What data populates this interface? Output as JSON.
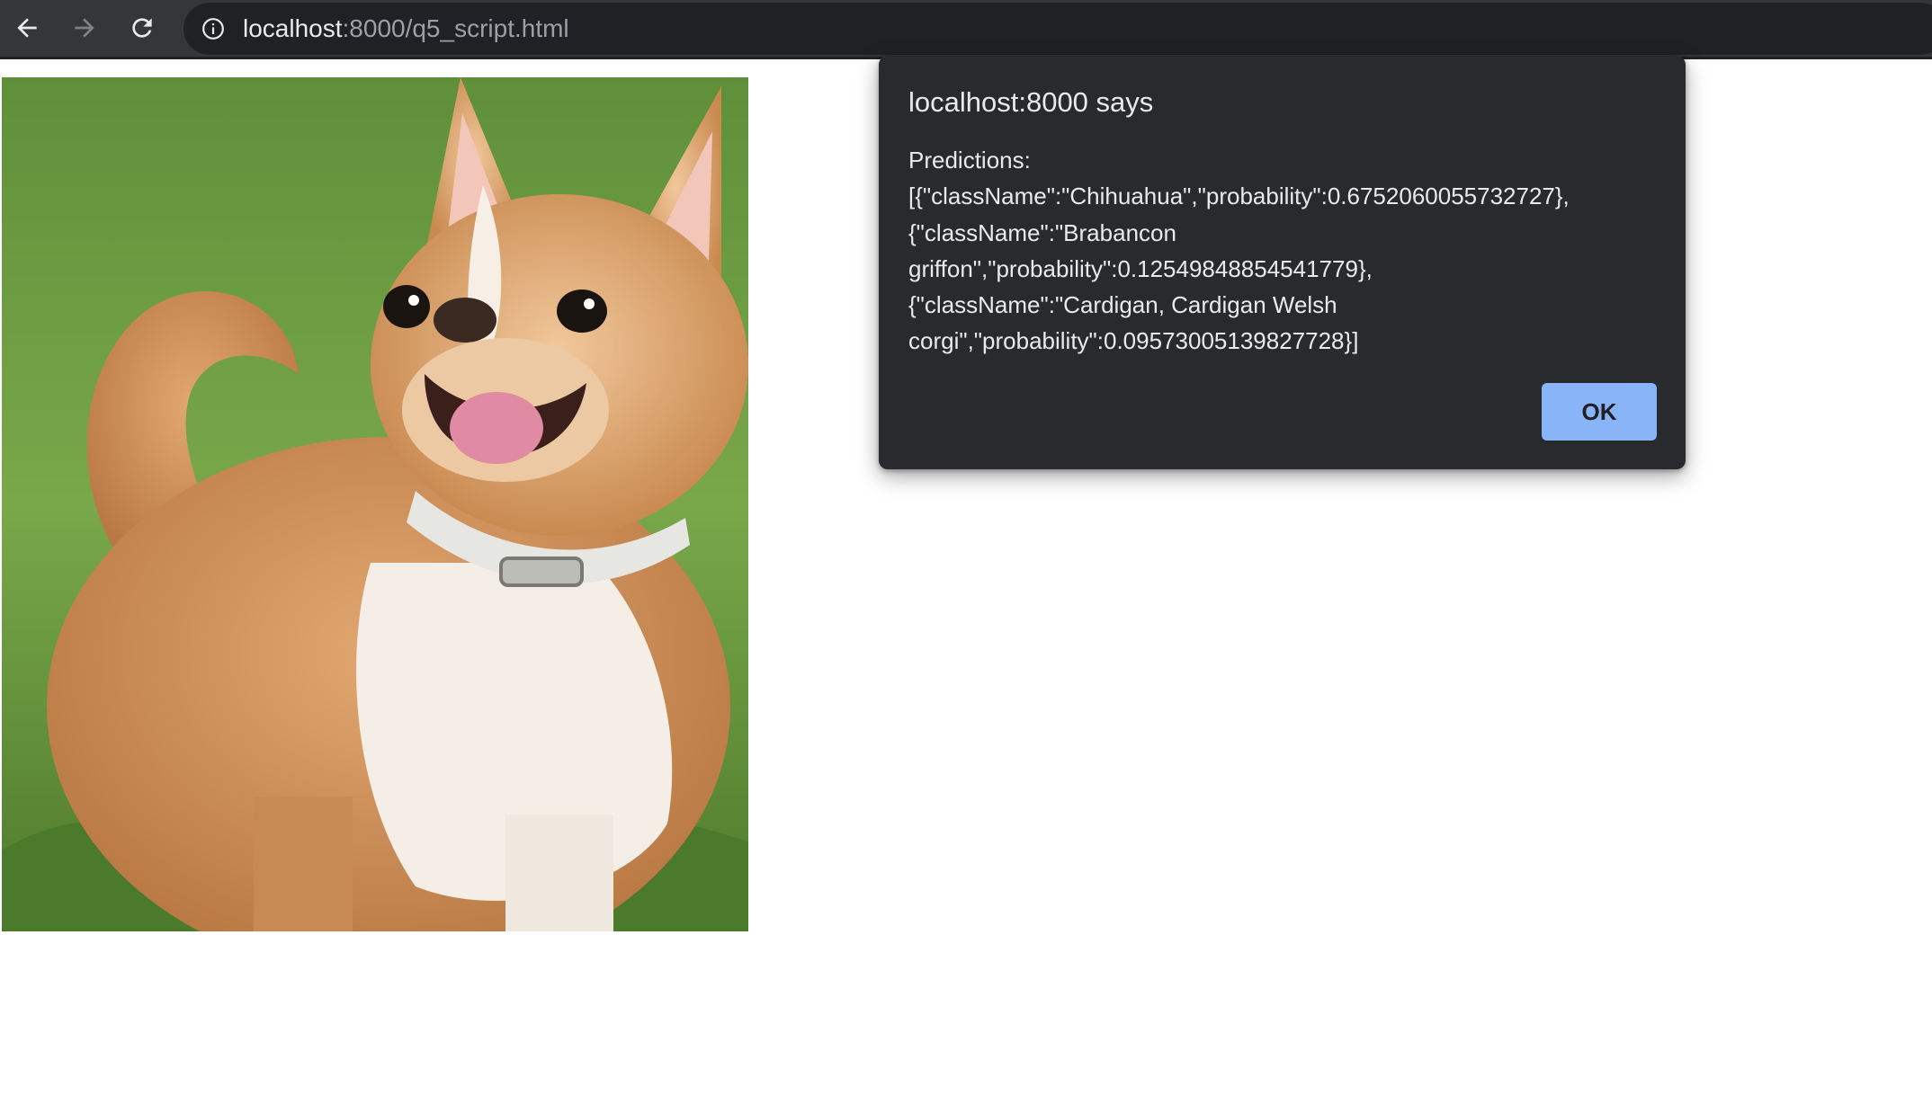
{
  "browser": {
    "back_icon": "arrow-left-icon",
    "forward_icon": "arrow-right-icon",
    "reload_icon": "reload-icon",
    "site_info_icon": "info-circle-icon",
    "url_host": "localhost",
    "url_path": ":8000/q5_script.html"
  },
  "page": {
    "image_subject": "chihuahua-dog-photo"
  },
  "dialog": {
    "title": "localhost:8000 says",
    "message": "Predictions:\n[{\"className\":\"Chihuahua\",\"probability\":0.6752060055732727},\n{\"className\":\"Brabancon\ngriffon\",\"probability\":0.12549848854541779},\n{\"className\":\"Cardigan, Cardigan Welsh\ncorgi\",\"probability\":0.09573005139827728}]",
    "ok_label": "OK"
  },
  "colors": {
    "toolbar_bg": "#35363a",
    "omnibox_bg": "#202124",
    "dialog_bg": "#292a2d",
    "ok_button_bg": "#8ab4f8"
  }
}
